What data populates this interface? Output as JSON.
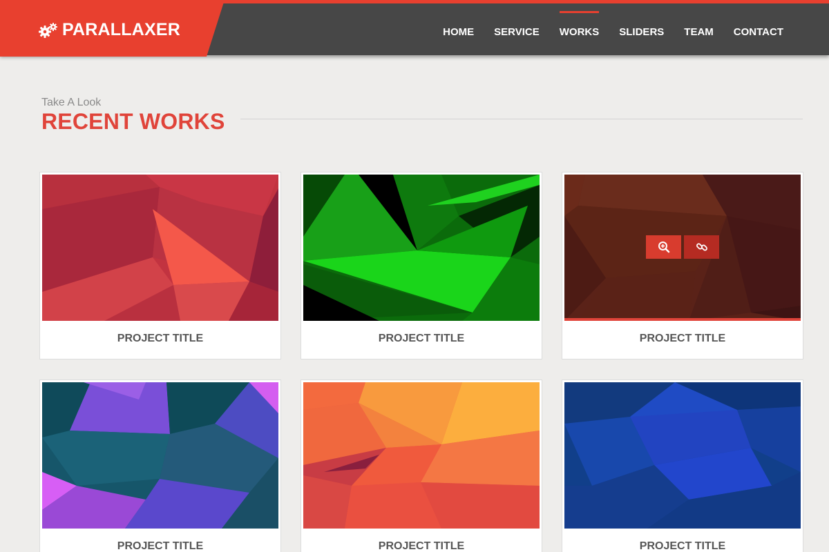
{
  "brand": {
    "name": "PARALLAXER",
    "icon": "gears-icon",
    "color": "#e8402f"
  },
  "nav": {
    "items": [
      {
        "label": "HOME"
      },
      {
        "label": "SERVICE"
      },
      {
        "label": "WORKS",
        "active": true
      },
      {
        "label": "SLIDERS"
      },
      {
        "label": "TEAM"
      },
      {
        "label": "CONTACT"
      }
    ]
  },
  "section": {
    "kicker": "Take A Look",
    "title": "RECENT WORKS"
  },
  "works": [
    {
      "title": "PROJECT TITLE",
      "palette": "red"
    },
    {
      "title": "PROJECT TITLE",
      "palette": "green"
    },
    {
      "title": "PROJECT TITLE",
      "palette": "brown",
      "hovered": true,
      "actions": [
        "zoom-in-icon",
        "link-icon"
      ]
    },
    {
      "title": "PROJECT TITLE",
      "palette": "teal-purple"
    },
    {
      "title": "PROJECT TITLE",
      "palette": "orange"
    },
    {
      "title": "PROJECT TITLE",
      "palette": "blue"
    }
  ]
}
